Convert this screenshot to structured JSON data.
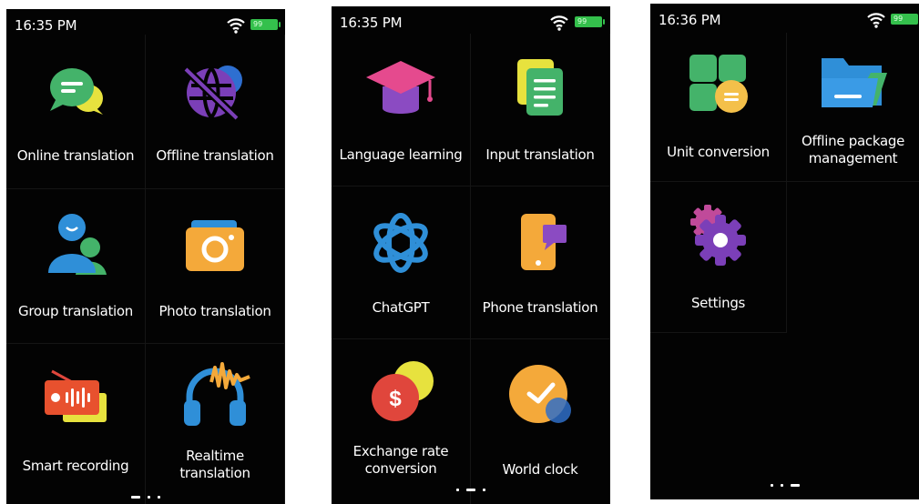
{
  "screens": [
    {
      "time": "16:35 PM",
      "battery": "99",
      "apps": [
        {
          "label": "Online translation",
          "icon": "chat-bubbles-icon"
        },
        {
          "label": "Offline translation",
          "icon": "globe-offline-icon"
        },
        {
          "label": "Group translation",
          "icon": "group-users-icon"
        },
        {
          "label": "Photo translation",
          "icon": "camera-icon"
        },
        {
          "label": "Smart recording",
          "icon": "radio-recorder-icon"
        },
        {
          "label": "Realtime translation",
          "icon": "headphones-icon"
        }
      ],
      "page_indicator": "page 1 of 3"
    },
    {
      "time": "16:35 PM",
      "battery": "99",
      "apps": [
        {
          "label": "Language learning",
          "icon": "graduation-cap-icon"
        },
        {
          "label": "Input translation",
          "icon": "document-icon"
        },
        {
          "label": "ChatGPT",
          "icon": "chatgpt-logo-icon"
        },
        {
          "label": "Phone translation",
          "icon": "phone-chat-icon"
        },
        {
          "label": "Exchange rate conversion",
          "icon": "currency-coin-icon"
        },
        {
          "label": "World clock",
          "icon": "clock-icon"
        }
      ],
      "page_indicator": "page 2 of 3"
    },
    {
      "time": "16:36 PM",
      "battery": "99",
      "apps": [
        {
          "label": "Unit conversion",
          "icon": "unit-grid-icon"
        },
        {
          "label": "Offline package management",
          "icon": "folder-icon"
        },
        {
          "label": "Settings",
          "icon": "gear-icon"
        }
      ],
      "page_indicator": "page 3 of 3"
    }
  ],
  "colors": {
    "background": "#030303",
    "text": "#ffffff",
    "battery": "#34c04c"
  }
}
